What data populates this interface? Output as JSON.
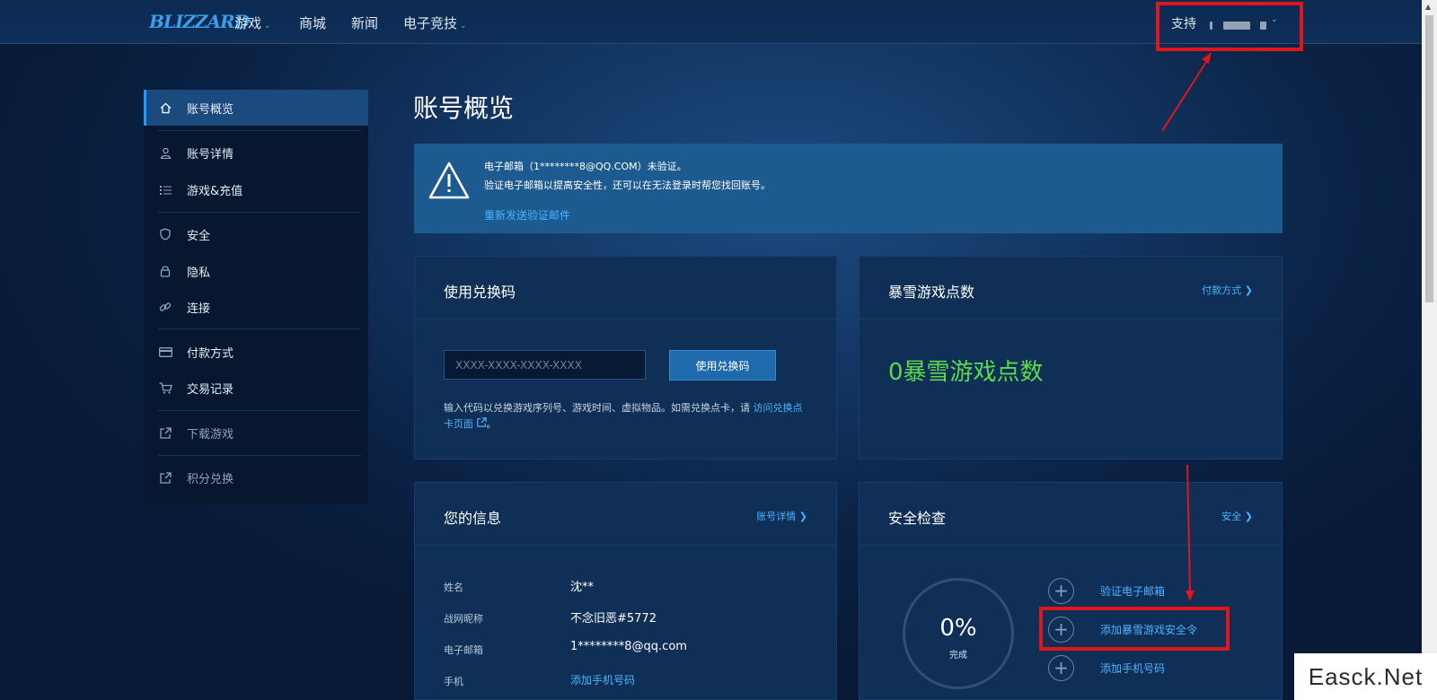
{
  "header": {
    "logo": "BLIZZARD",
    "nav": [
      {
        "label": "游戏",
        "dropdown": true
      },
      {
        "label": "商城",
        "dropdown": false
      },
      {
        "label": "新闻",
        "dropdown": false
      },
      {
        "label": "电子竞技",
        "dropdown": true
      }
    ],
    "support": "支持"
  },
  "sidebar": {
    "items": [
      {
        "label": "账号概览",
        "icon": "home-icon",
        "active": true
      },
      {
        "label": "账号详情",
        "icon": "user-icon"
      },
      {
        "label": "游戏&充值",
        "icon": "list-icon"
      },
      {
        "label": "安全",
        "icon": "shield-icon"
      },
      {
        "label": "隐私",
        "icon": "lock-icon"
      },
      {
        "label": "连接",
        "icon": "link-icon"
      },
      {
        "label": "付款方式",
        "icon": "card-icon"
      },
      {
        "label": "交易记录",
        "icon": "cart-icon"
      },
      {
        "label": "下载游戏",
        "icon": "external-link-icon"
      },
      {
        "label": "积分兑换",
        "icon": "external-link-icon"
      }
    ]
  },
  "main": {
    "title": "账号概览",
    "alert": {
      "line1": "电子邮箱（1********8@QQ.COM）未验证。",
      "line2": "验证电子邮箱以提高安全性，还可以在无法登录时帮您找回账号。",
      "link": "重新发送验证邮件"
    },
    "redeem": {
      "title": "使用兑换码",
      "placeholder": "XXXX-XXXX-XXXX-XXXX",
      "button": "使用兑换码",
      "help": "输入代码以兑换游戏序列号、游戏时间、虚拟物品。如需兑换点卡，请 ",
      "help_link": "访问兑换点卡页面"
    },
    "points": {
      "title": "暴雪游戏点数",
      "link": "付款方式",
      "value": "0暴雪游戏点数"
    },
    "info": {
      "title": "您的信息",
      "link": "账号详情",
      "rows": [
        {
          "label": "姓名",
          "value": "沈**"
        },
        {
          "label": "战网昵称",
          "value": "不念旧恶#5772"
        },
        {
          "label": "电子邮箱",
          "value": "1********8@qq.com"
        },
        {
          "label": "手机",
          "value": "添加手机号码"
        }
      ]
    },
    "security": {
      "title": "安全检查",
      "link": "安全",
      "percent": "0%",
      "percent_label": "完成",
      "actions": [
        "验证电子邮箱",
        "添加暴雪游戏安全令",
        "添加手机号码"
      ]
    }
  },
  "watermark": "Easck.Net",
  "colors": {
    "accent": "#4ab3ff",
    "points": "#5dd94b",
    "annotation": "#e0161b"
  }
}
